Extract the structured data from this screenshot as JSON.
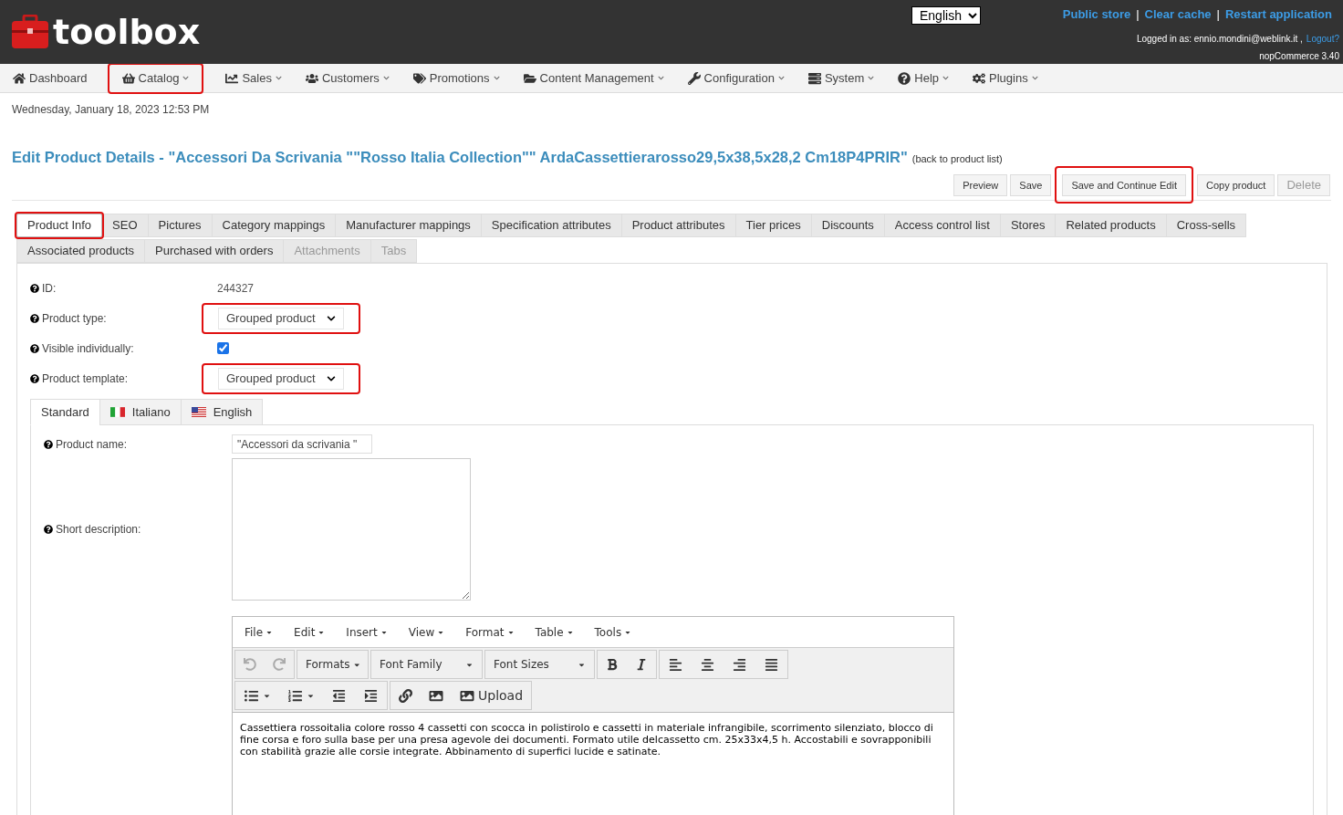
{
  "header": {
    "logo_text": "toolbox",
    "language": "English",
    "links": [
      {
        "label": "Public store"
      },
      {
        "label": "Clear cache"
      },
      {
        "label": "Restart application"
      }
    ],
    "separator": "|",
    "logged_in": "Logged in as: ennio.mondini@weblink.it ,",
    "logout": "Logout?",
    "version": "nopCommerce 3.40"
  },
  "nav": [
    {
      "label": "Dashboard",
      "has_menu": false,
      "highlighted": false
    },
    {
      "label": "Catalog",
      "has_menu": true,
      "highlighted": true
    },
    {
      "label": "Sales",
      "has_menu": true,
      "highlighted": false
    },
    {
      "label": "Customers",
      "has_menu": true,
      "highlighted": false
    },
    {
      "label": "Promotions",
      "has_menu": true,
      "highlighted": false
    },
    {
      "label": "Content Management",
      "has_menu": true,
      "highlighted": false
    },
    {
      "label": "Configuration",
      "has_menu": true,
      "highlighted": false
    },
    {
      "label": "System",
      "has_menu": true,
      "highlighted": false
    },
    {
      "label": "Help",
      "has_menu": true,
      "highlighted": false
    },
    {
      "label": "Plugins",
      "has_menu": true,
      "highlighted": false
    }
  ],
  "date": "Wednesday, January 18, 2023 12:53 PM",
  "title": "Edit Product Details - \"Accessori Da Scrivania \"\"Rosso Italia Collection\"\" ArdaCassettierarosso29,5x38,5x28,2 Cm18P4PRIR\"",
  "back_link": "(back to product list)",
  "actions": [
    {
      "label": "Preview",
      "disabled": false,
      "highlighted": false
    },
    {
      "label": "Save",
      "disabled": false,
      "highlighted": false
    },
    {
      "label": "Save and Continue Edit",
      "disabled": false,
      "highlighted": true
    },
    {
      "label": "Copy product",
      "disabled": false,
      "highlighted": false
    },
    {
      "label": "Delete",
      "disabled": true,
      "highlighted": false
    }
  ],
  "tabs": [
    {
      "label": "Product Info",
      "selected": true,
      "disabled": false,
      "highlighted": true
    },
    {
      "label": "SEO",
      "selected": false,
      "disabled": false,
      "highlighted": false
    },
    {
      "label": "Pictures",
      "selected": false,
      "disabled": false,
      "highlighted": false
    },
    {
      "label": "Category mappings",
      "selected": false,
      "disabled": false,
      "highlighted": false
    },
    {
      "label": "Manufacturer mappings",
      "selected": false,
      "disabled": false,
      "highlighted": false
    },
    {
      "label": "Specification attributes",
      "selected": false,
      "disabled": false,
      "highlighted": false
    },
    {
      "label": "Product attributes",
      "selected": false,
      "disabled": false,
      "highlighted": false
    },
    {
      "label": "Tier prices",
      "selected": false,
      "disabled": false,
      "highlighted": false
    },
    {
      "label": "Discounts",
      "selected": false,
      "disabled": false,
      "highlighted": false
    },
    {
      "label": "Access control list",
      "selected": false,
      "disabled": false,
      "highlighted": false
    },
    {
      "label": "Stores",
      "selected": false,
      "disabled": false,
      "highlighted": false
    },
    {
      "label": "Related products",
      "selected": false,
      "disabled": false,
      "highlighted": false
    },
    {
      "label": "Cross-sells",
      "selected": false,
      "disabled": false,
      "highlighted": false
    },
    {
      "label": "Associated products",
      "selected": false,
      "disabled": false,
      "highlighted": false
    },
    {
      "label": "Purchased with orders",
      "selected": false,
      "disabled": false,
      "highlighted": false
    },
    {
      "label": "Attachments",
      "selected": false,
      "disabled": true,
      "highlighted": false
    },
    {
      "label": "Tabs",
      "selected": false,
      "disabled": true,
      "highlighted": false
    }
  ],
  "fields": [
    {
      "kind": "text",
      "label": "ID:",
      "value": "244327"
    },
    {
      "kind": "select",
      "label": "Product type:",
      "value": "Grouped product",
      "highlighted": true
    },
    {
      "kind": "checkbox",
      "label": "Visible individually:",
      "checked": true
    },
    {
      "kind": "select",
      "label": "Product template:",
      "value": "Grouped product",
      "highlighted": true
    }
  ],
  "language_tabs": [
    {
      "label": "Standard",
      "kind": "plain",
      "selected": true
    },
    {
      "label": "Italiano",
      "kind": "italian",
      "selected": false
    },
    {
      "label": "English",
      "kind": "american",
      "selected": false
    }
  ],
  "product_name": {
    "label": "Product name:",
    "value": "\"Accessori da scrivania \""
  },
  "short_description": {
    "label": "Short description:"
  },
  "editor": {
    "menus": [
      "File",
      "Edit",
      "Insert",
      "View",
      "Format",
      "Table",
      "Tools"
    ],
    "formats": "Formats",
    "font_family": "Font Family",
    "font_sizes": "Font Sizes",
    "upload": "Upload",
    "content": "Cassettiera rossoitalia colore rosso 4 cassetti con scocca in polistirolo e cassetti in materiale infrangibile, scorrimento silenziato, blocco di fine corsa e foro sulla base per una presa agevole dei documenti. Formato utile delcassetto cm. 25x33x4,5 h. Accostabili e sovrapponibili con stabilità grazie alle corsie integrate. Abbinamento di superfici lucide e satinate."
  }
}
